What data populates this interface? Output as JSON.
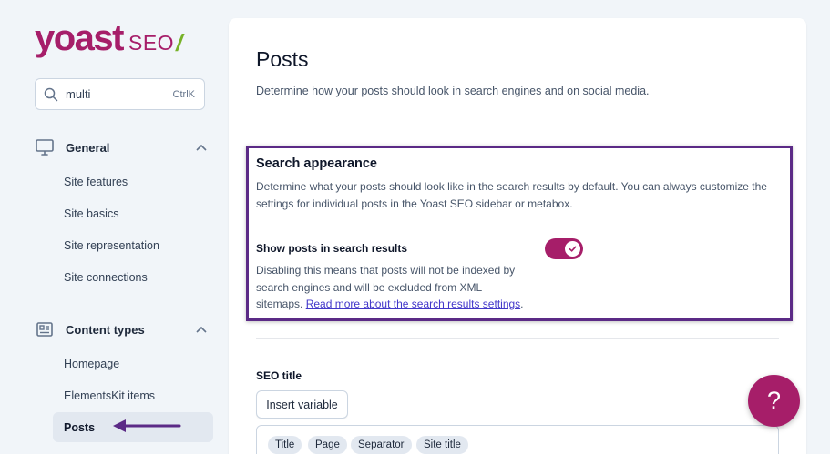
{
  "logo": {
    "word": "yoast",
    "seo": "SEO",
    "slash": "/"
  },
  "search": {
    "value": "multi",
    "shortcut": "CtrlK"
  },
  "sidebar": {
    "general": {
      "title": "General",
      "items": [
        "Site features",
        "Site basics",
        "Site representation",
        "Site connections"
      ]
    },
    "content_types": {
      "title": "Content types",
      "items": [
        "Homepage",
        "ElementsKit items",
        "Posts"
      ],
      "active": "Posts"
    }
  },
  "main": {
    "title": "Posts",
    "description": "Determine how your posts should look in search engines and on social media.",
    "search_appearance": {
      "title": "Search appearance",
      "description": "Determine what your posts should look like in the search results by default. You can always customize the settings for individual posts in the Yoast SEO sidebar or metabox."
    },
    "show_posts": {
      "label": "Show posts in search results",
      "description": "Disabling this means that posts will not be indexed by search engines and will be excluded from XML sitemaps.",
      "link_text": "Read more about the search results settings",
      "link_suffix": ".",
      "enabled": true
    },
    "seo_title": {
      "label": "SEO title",
      "insert_button": "Insert variable",
      "tags": [
        "Title",
        "Page",
        "Separator",
        "Site title"
      ]
    }
  },
  "help": {
    "label": "?"
  },
  "colors": {
    "brand": "#a61e69",
    "highlight": "#5b2a86",
    "link": "#4338ca",
    "slash": "#77b227"
  }
}
